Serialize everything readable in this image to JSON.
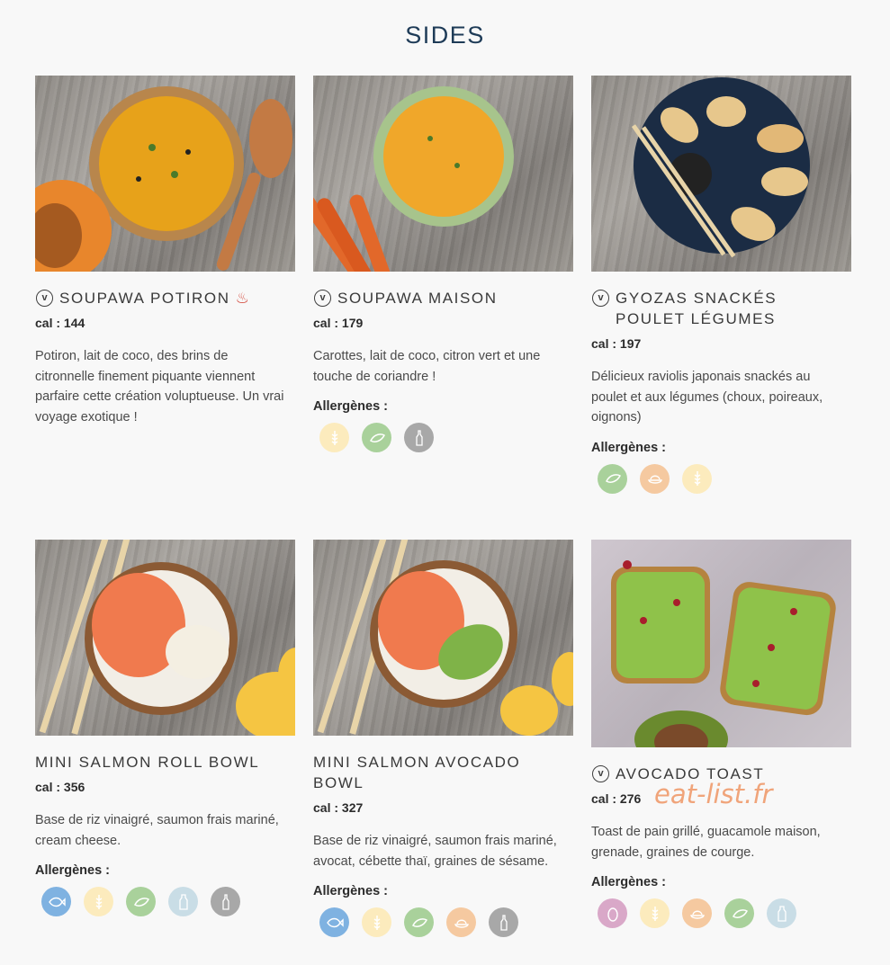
{
  "page": {
    "title": "SIDES",
    "watermark": "eat-list.fr"
  },
  "colors": {
    "title": "#1e3b57",
    "gluten": "#fcebbd",
    "celery": "#a9d19b",
    "soy_orange": "#f5c9a0",
    "sesame_grey": "#a8a8a8",
    "fish_blue": "#7fb2e1",
    "milk_lightblue": "#c9dde6",
    "egg_pink": "#d9a8c8"
  },
  "cards": [
    {
      "name": "SOUPAWA POTIRON",
      "hot_icon": "hot-dish-icon",
      "veg": true,
      "cal_label": "cal : 144",
      "desc": "Potiron, lait de coco, des brins de citronnelle finement piquante viennent parfaire cette création voluptueuse. Un vrai voyage exotique !",
      "allergen_title": "",
      "allergens": []
    },
    {
      "name": "SOUPAWA MAISON",
      "veg": true,
      "cal_label": "cal : 179",
      "desc": "Carottes, lait de coco, citron vert et une touche de coriandre !",
      "allergen_title": "Allergènes :",
      "allergens": [
        "gluten-icon",
        "celery-icon",
        "mustard-bottle-icon"
      ]
    },
    {
      "name": "GYOZAS SNACKÉS POULET LÉGUMES",
      "veg": true,
      "cal_label": "cal : 197",
      "desc": "Délicieux raviolis japonais snackés au poulet et aux légumes (choux, poireaux, oignons)",
      "allergen_title": "Allergènes :",
      "allergens": [
        "celery-icon",
        "soy-icon",
        "gluten-icon"
      ]
    },
    {
      "name": "MINI SALMON ROLL BOWL",
      "veg": false,
      "cal_label": "cal : 356",
      "desc": "Base de riz vinaigré, saumon frais mariné, cream cheese.",
      "allergen_title": "Allergènes :",
      "allergens": [
        "fish-icon",
        "gluten-icon",
        "celery-icon",
        "milk-icon",
        "mustard-bottle-icon"
      ]
    },
    {
      "name": "MINI SALMON AVOCADO BOWL",
      "veg": false,
      "cal_label": "cal : 327",
      "desc": "Base de riz vinaigré, saumon frais mariné, avocat, cébette thaï, graines de sésame.",
      "allergen_title": "Allergènes :",
      "allergens": [
        "fish-icon",
        "gluten-icon",
        "celery-icon",
        "soy-icon",
        "mustard-bottle-icon"
      ]
    },
    {
      "name": "AVOCADO TOAST",
      "veg": true,
      "cal_label": "cal : 276",
      "desc": "Toast de pain grillé, guacamole maison, grenade, graines de courge.",
      "allergen_title": "Allergènes :",
      "allergens": [
        "egg-icon",
        "gluten-icon",
        "soy-icon",
        "celery-icon",
        "milk-icon"
      ]
    }
  ]
}
